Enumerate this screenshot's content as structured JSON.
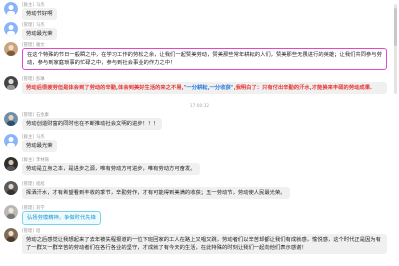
{
  "messages": [
    {
      "sender_role": "[群主]",
      "sender_name": "马杰",
      "text": "劳动节好啊",
      "style": "plain"
    },
    {
      "sender_role": "[管理]",
      "sender_name": "马杰",
      "text": "劳动最光荣",
      "style": "plain"
    },
    {
      "sender_role": "[管理]",
      "sender_name": "雅文",
      "text": "在这个特殊的节日一般瞬之中，在学习工作的劳松之余，让我们一起赞美劳动，赞美那些常年耕耘的人们，赞美那些无畏进行的英雄；让我们共同参与劳动，参与到家庭琐事的忙碌之中，参与到社会事业的作力之中！",
      "style": "pink"
    },
    {
      "sender_role": "[管理]",
      "sender_name": "彭琳",
      "parts": [
        {
          "t": "劳动后很疲劳但是体会到了劳动的辛勤,体会到美好生活的来之不易,",
          "c": "red"
        },
        {
          "t": "\"一分耕耘,一分收获\"",
          "c": "blue"
        },
        {
          "t": ",我明白了：只有付出辛勤的汗水,才能换来丰硕的劳动成果.",
          "c": "red"
        }
      ],
      "style": "plain"
    },
    {
      "sender_role": "[管理]",
      "sender_name": "石金康",
      "text": "劳动创造财富的同时也在不断推动社会文明的进步！！！",
      "style": "plain"
    },
    {
      "sender_role": "[群主]",
      "sender_name": "马杰",
      "text": "劳动最光荣",
      "style": "plain"
    },
    {
      "sender_role": "[群主]",
      "sender_name": "李林锦",
      "text": "劳动是立身之本，是进步之源，唯有劳动方可进步，唯有劳动方可奋发。",
      "style": "plain"
    },
    {
      "sender_role": "[管理]",
      "sender_name": "程旭",
      "text": "挥洒汗水，才有希望看到丰收的季节，辛勤劳作，才有可能得到美满的收获；五一劳动节，劳动使人民最光荣。",
      "style": "plain"
    },
    {
      "sender_role": "[管理]",
      "sender_name": "刘学",
      "text": "弘扬劳模精神，争做时代先锋",
      "style": "cyan"
    },
    {
      "sender_role": "[管理]",
      "sender_name": "旭",
      "text": "劳动之后感觉让我想起来了去年被失程报道的一位下班回家的工人在路上又唱又跳，劳动者们以辛苦却都让我们有成就感，愉悦感，这个时代正是因为有了一群又一群辛苦的劳动者们在各行各业的坚守，才成就了有今天的生活，在此特殊的时刻让我们一起向他们表示感谢！",
      "style": "plain"
    }
  ],
  "time_divider": "17:00:32"
}
